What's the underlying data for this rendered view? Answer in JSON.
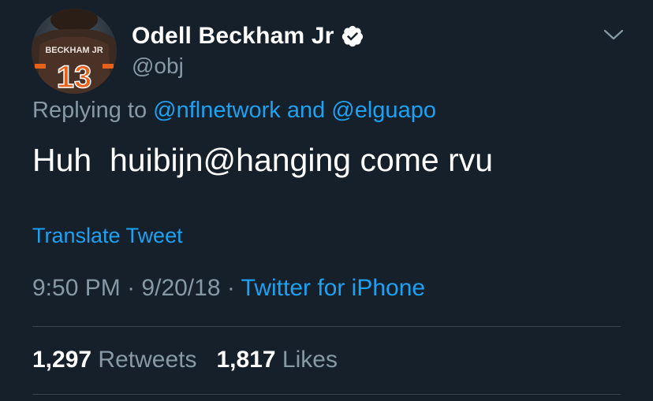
{
  "user": {
    "display_name": "Odell Beckham Jr",
    "handle": "@obj",
    "verified": true,
    "avatar_jersey_name": "BECKHAM JR",
    "avatar_jersey_number": "13"
  },
  "reply": {
    "prefix": "Replying to",
    "user1": "@nflnetwork",
    "connector": "and",
    "user2": "@elguapo"
  },
  "tweet": {
    "text": "Huh  huibijn@hanging come rvu",
    "translate_label": "Translate Tweet"
  },
  "meta": {
    "time": "9:50 PM",
    "separator": "·",
    "date": "9/20/18",
    "source": "Twitter for iPhone"
  },
  "stats": {
    "retweets_count": "1,297",
    "retweets_label": "Retweets",
    "likes_count": "1,817",
    "likes_label": "Likes"
  },
  "colors": {
    "background": "#15202b",
    "accent": "#1da1f2",
    "secondary_text": "#8899a6",
    "divider": "#38444d"
  },
  "icons": {
    "verified": "verified-badge-icon",
    "menu": "chevron-down-icon"
  }
}
